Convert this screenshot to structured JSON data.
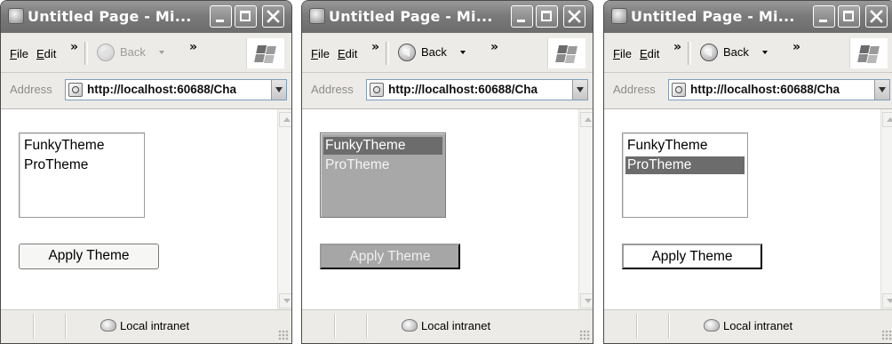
{
  "windows": [
    {
      "title": "Untitled Page - Mi...",
      "menu": {
        "file": "File",
        "file_key": "F",
        "edit": "Edit",
        "edit_key": "E",
        "overflow": "»"
      },
      "toolbar": {
        "back_label": "Back",
        "back_enabled": false,
        "overflow": "»"
      },
      "address": {
        "label": "Address",
        "url": "http://localhost:60688/Cha"
      },
      "listbox": {
        "items": [
          "FunkyTheme",
          "ProTheme"
        ],
        "selected_index": -1,
        "bg": "#ffffff",
        "border": "#9a9a9a",
        "text_color": "#000000",
        "selected_bg": "#ffffff",
        "selected_fg": "#000000"
      },
      "apply_button": {
        "label": "Apply Theme",
        "bg": "#f6f6f4",
        "fg": "#000000",
        "border": "#7a7a7a",
        "rounded": true
      },
      "status": {
        "zone": "Local intranet"
      }
    },
    {
      "title": "Untitled Page - Mi...",
      "menu": {
        "file": "File",
        "file_key": "F",
        "edit": "Edit",
        "edit_key": "E",
        "overflow": "»"
      },
      "toolbar": {
        "back_label": "Back",
        "back_enabled": true,
        "overflow": "»"
      },
      "address": {
        "label": "Address",
        "url": "http://localhost:60688/Cha"
      },
      "listbox": {
        "items": [
          "FunkyTheme",
          "ProTheme"
        ],
        "selected_index": 0,
        "bg": "#a8a8a8",
        "border": "#7a7a7a",
        "text_color": "#f4f4f4",
        "selected_bg": "#6c6c6c",
        "selected_fg": "#ffffff"
      },
      "apply_button": {
        "label": "Apply Theme",
        "bg": "#a6a6a6",
        "fg": "#f0f0f0",
        "border": "#000000",
        "rounded": false
      },
      "status": {
        "zone": "Local intranet"
      }
    },
    {
      "title": "Untitled Page - Mi...",
      "menu": {
        "file": "File",
        "file_key": "F",
        "edit": "Edit",
        "edit_key": "E",
        "overflow": "»"
      },
      "toolbar": {
        "back_label": "Back",
        "back_enabled": true,
        "overflow": "»"
      },
      "address": {
        "label": "Address",
        "url": "http://localhost:60688/Cha"
      },
      "listbox": {
        "items": [
          "FunkyTheme",
          "ProTheme"
        ],
        "selected_index": 1,
        "bg": "#ffffff",
        "border": "#9a9a9a",
        "text_color": "#000000",
        "selected_bg": "#6c6c6c",
        "selected_fg": "#ffffff"
      },
      "apply_button": {
        "label": "Apply Theme",
        "bg": "#ffffff",
        "fg": "#000000",
        "border": "#000000",
        "rounded": false
      },
      "status": {
        "zone": "Local intranet"
      }
    }
  ]
}
